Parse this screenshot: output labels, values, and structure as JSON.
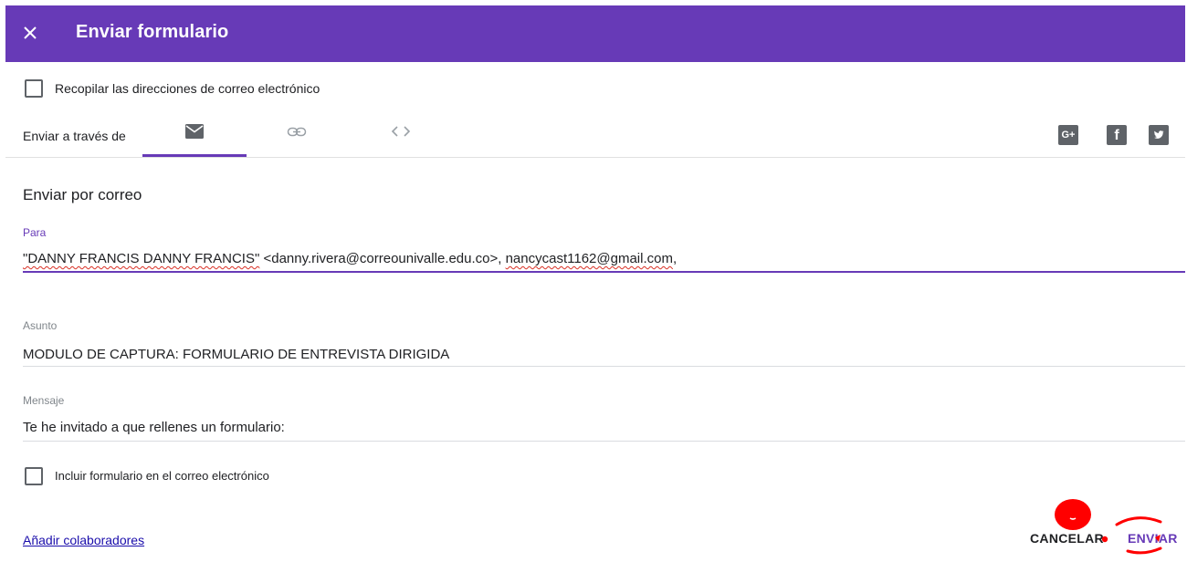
{
  "header": {
    "title": "Enviar formulario",
    "close_icon": "close-icon"
  },
  "collect_emails": {
    "label": "Recopilar las direcciones de correo electrónico",
    "checked": false
  },
  "send_via": {
    "label": "Enviar a través de",
    "tabs": [
      {
        "icon": "email-icon",
        "selected": true
      },
      {
        "icon": "link-icon",
        "selected": false
      },
      {
        "icon": "embed-code-icon",
        "selected": false
      }
    ],
    "accent_color": "#673ab7"
  },
  "social": {
    "google_plus": "G+",
    "facebook": "f",
    "twitter_icon": "twitter-icon"
  },
  "email_form": {
    "section_title": "Enviar por correo",
    "to": {
      "label": "Para",
      "recipient_name": "\"DANNY FRANCIS DANNY FRANCIS\"",
      "recipient_email": "<danny.rivera@correounivalle.edu.co>",
      "separator": ", ",
      "second_recipient": "nancycast1162@gmail.com",
      "trailing": ","
    },
    "subject": {
      "label": "Asunto",
      "value": "MODULO DE CAPTURA: FORMULARIO DE ENTREVISTA DIRIGIDA"
    },
    "message": {
      "label": "Mensaje",
      "value": "Te he invitado a que rellenes un formulario:"
    },
    "include_form": {
      "label": "Incluir formulario en el correo electrónico",
      "checked": false
    }
  },
  "footer": {
    "add_collaborators": "Añadir colaboradores",
    "cancel": "CANCELAR",
    "send": "ENVIAR"
  },
  "colors": {
    "header_bg": "#673ab7",
    "link": "#1a0dab",
    "annotation": "#ff0000"
  }
}
